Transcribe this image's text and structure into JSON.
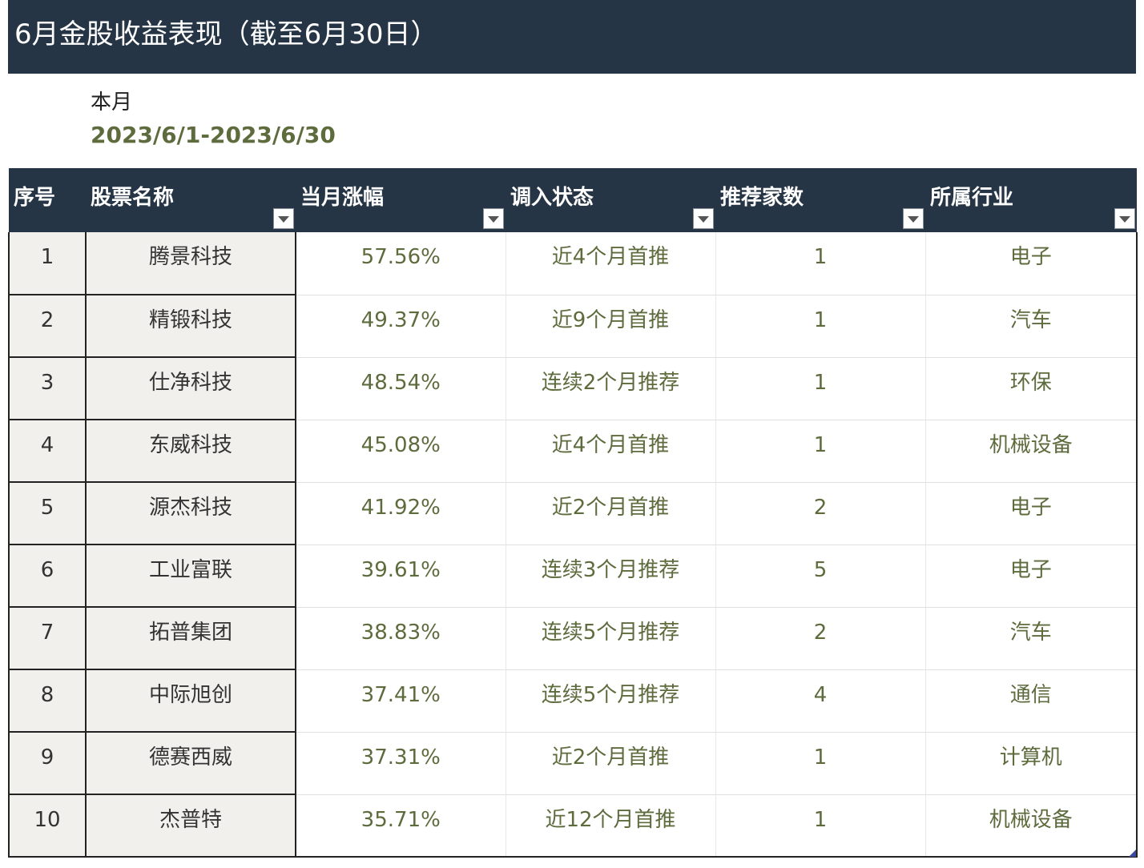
{
  "title": "6月金股收益表现（截至6月30日）",
  "period": {
    "label": "本月",
    "range": "2023/6/1-2023/6/30"
  },
  "table": {
    "headers": [
      "序号",
      "股票名称",
      "当月涨幅",
      "调入状态",
      "推荐家数",
      "所属行业"
    ],
    "rows": [
      [
        "1",
        "腾景科技",
        "57.56%",
        "近4个月首推",
        "1",
        "电子"
      ],
      [
        "2",
        "精锻科技",
        "49.37%",
        "近9个月首推",
        "1",
        "汽车"
      ],
      [
        "3",
        "仕净科技",
        "48.54%",
        "连续2个月推荐",
        "1",
        "环保"
      ],
      [
        "4",
        "东威科技",
        "45.08%",
        "近4个月首推",
        "1",
        "机械设备"
      ],
      [
        "5",
        "源杰科技",
        "41.92%",
        "近2个月首推",
        "2",
        "电子"
      ],
      [
        "6",
        "工业富联",
        "39.61%",
        "连续3个月推荐",
        "5",
        "电子"
      ],
      [
        "7",
        "拓普集团",
        "38.83%",
        "连续5个月推荐",
        "2",
        "汽车"
      ],
      [
        "8",
        "中际旭创",
        "37.41%",
        "连续5个月推荐",
        "4",
        "通信"
      ],
      [
        "9",
        "德赛西威",
        "37.31%",
        "近2个月首推",
        "1",
        "计算机"
      ],
      [
        "10",
        "杰普特",
        "35.71%",
        "近12个月首推",
        "1",
        "机械设备"
      ]
    ]
  },
  "colors": {
    "header_bg": "#263545",
    "value_text": "#5d6b3d",
    "frozen_col_bg": "#f2f0ec"
  },
  "icons": {
    "filter": "filter-dropdown-icon"
  }
}
